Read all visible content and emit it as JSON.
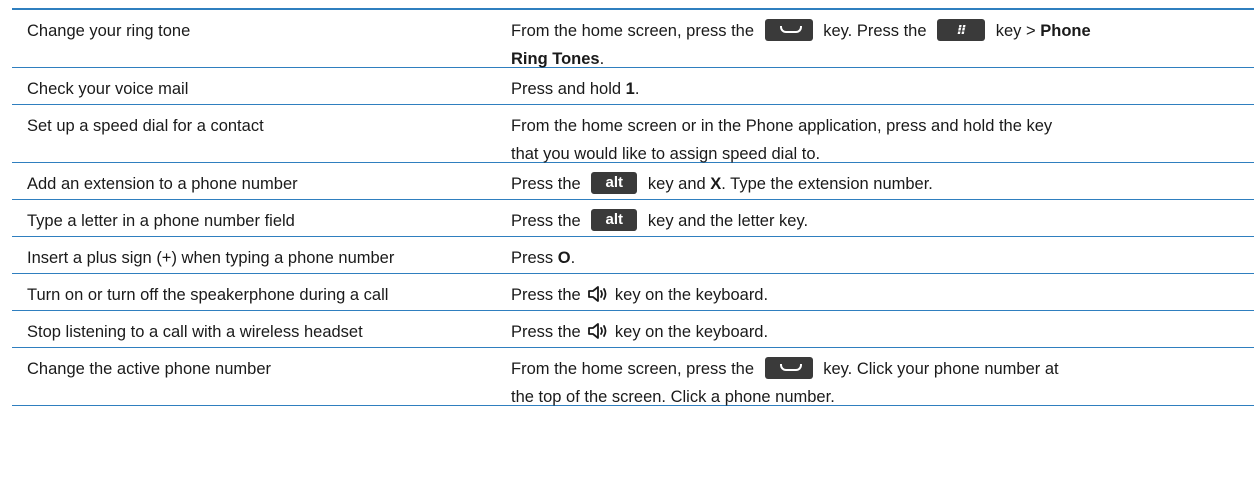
{
  "rows": [
    {
      "task": "Change your ring tone",
      "a1": "From the home screen, press the",
      "a2": "key. Press the",
      "a3": "key >",
      "b1": "Phone",
      "b2": "Ring Tones",
      "a4": "."
    },
    {
      "task": "Check your voice mail",
      "a1": "Press and hold",
      "b1": "1",
      "a2": "."
    },
    {
      "task": "Set up a speed dial for a contact",
      "a1": "From the home screen or in the Phone application, press and hold the key",
      "a2": "that you would like to assign speed dial to."
    },
    {
      "task": "Add an extension to a phone number",
      "a1": "Press the",
      "key": "alt",
      "a2": "key and",
      "b1": "X",
      "a3": ". Type the extension number."
    },
    {
      "task": "Type a letter in a phone number field",
      "a1": "Press the",
      "key": "alt",
      "a2": "key and the letter key."
    },
    {
      "task": "Insert a plus sign (+) when typing a phone number",
      "a1": "Press",
      "b1": "O",
      "a2": "."
    },
    {
      "task": "Turn on or turn off the speakerphone during a call",
      "a1": "Press the",
      "a2": "key on the keyboard."
    },
    {
      "task": "Stop listening to a call with a wireless headset",
      "a1": "Press the",
      "a2": "key on the keyboard."
    },
    {
      "task": "Change the active phone number",
      "a1": "From the home screen, press the",
      "a2": "key. Click your phone number at",
      "a3": "the top of the screen. Click a phone number."
    }
  ],
  "icons": {
    "send": "send-key-icon",
    "menu": "menu-key-icon",
    "speaker": "speaker-key-icon"
  },
  "colors": {
    "rule": "#2f7fbf",
    "key_bg": "#3a3a3a"
  }
}
